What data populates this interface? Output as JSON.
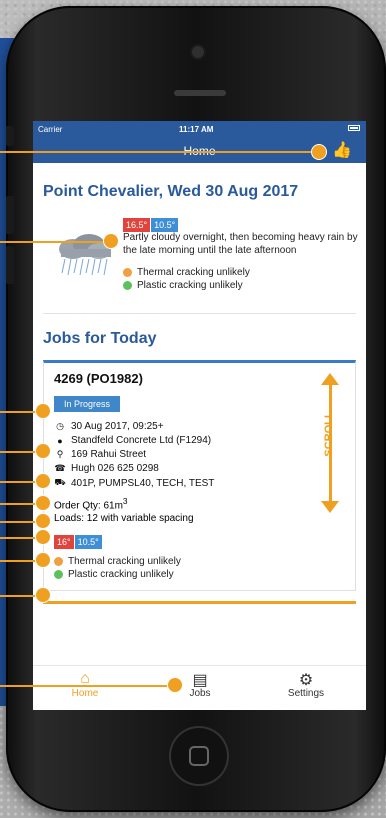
{
  "status_bar": {
    "carrier": "Carrier",
    "time": "11:17 AM"
  },
  "nav": {
    "title": "Home"
  },
  "weather": {
    "location_date": "Point Chevalier, Wed 30 Aug 2017",
    "temp_high": "16.5°",
    "temp_low": "10.5°",
    "description": "Partly cloudy overnight, then becoming heavy rain by the late morning until the late afternoon",
    "thermal": "Thermal cracking unlikely",
    "plastic": "Plastic cracking unlikely"
  },
  "jobs": {
    "section_title": "Jobs for Today",
    "job": {
      "id": "4269 (PO1982)",
      "status": "In Progress",
      "datetime": "30 Aug 2017, 09:25+",
      "customer": "Standfeld Concrete Ltd (F1294)",
      "address": "169 Rahui Street",
      "contact": "Hugh 026 625 0298",
      "equipment": "401P, PUMPSL40, TECH, TEST",
      "order_qty_prefix": "Order Qty: 61m",
      "order_qty_sup": "3",
      "loads": "Loads: 12 with variable spacing",
      "temp_high": "16°",
      "temp_low": "10.5°",
      "thermal": "Thermal cracking unlikely",
      "plastic": "Plastic cracking unlikely"
    }
  },
  "scroll_hint": "SCROLL",
  "tabs": {
    "home": "Home",
    "jobs": "Jobs",
    "settings": "Settings"
  },
  "icons": {
    "thumb": "thumbs-up-icon",
    "clock": "clock-icon",
    "person": "person-icon",
    "pin": "map-pin-icon",
    "phone": "phone-icon",
    "truck": "truck-icon",
    "home": "home-icon",
    "jobs": "document-icon",
    "settings": "gears-icon"
  },
  "colors": {
    "accent": "#f0a020",
    "brand_blue": "#2a5a9c",
    "red": "#e0443c",
    "blue": "#3f8fd6"
  }
}
